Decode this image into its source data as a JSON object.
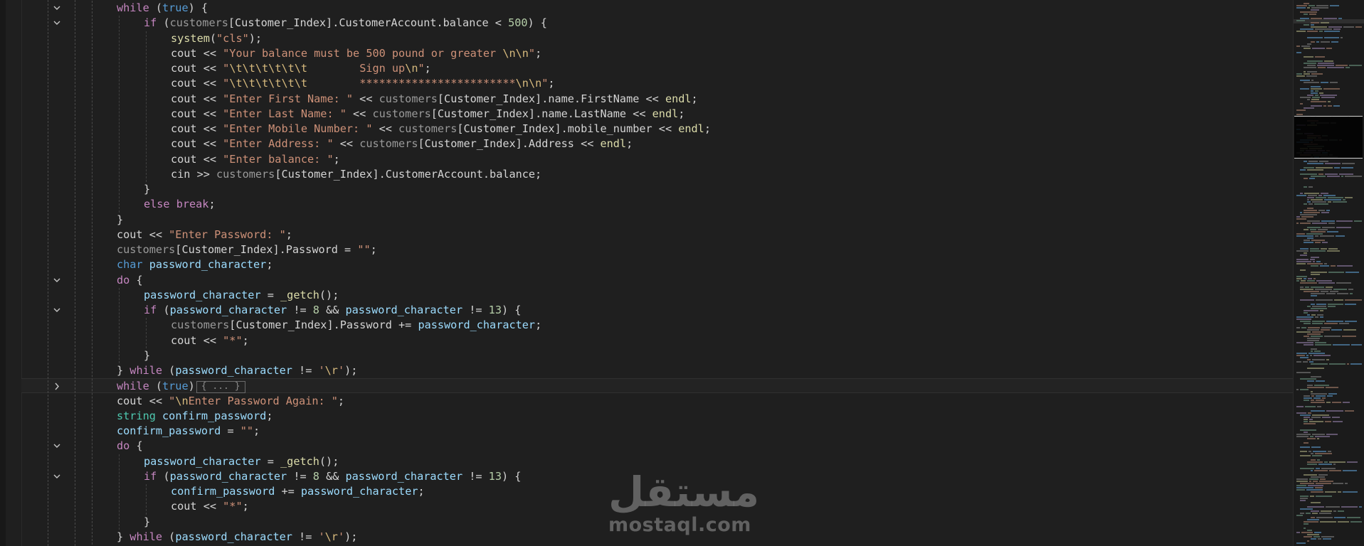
{
  "editor": {
    "collapsed_placeholder": "{ ... }",
    "lines": [
      {
        "fold": "expanded",
        "indent": 1,
        "tokens": [
          [
            "ctl",
            "while"
          ],
          [
            "txt",
            " ("
          ],
          [
            "kw",
            "true"
          ],
          [
            "txt",
            ") {"
          ]
        ]
      },
      {
        "fold": "expanded",
        "indent": 2,
        "tokens": [
          [
            "ctl",
            "if"
          ],
          [
            "txt",
            " ("
          ],
          [
            "gray",
            "customers"
          ],
          [
            "txt",
            "[Customer_Index].CustomerAccount.balance < "
          ],
          [
            "num",
            "500"
          ],
          [
            "txt",
            ") {"
          ]
        ]
      },
      {
        "fold": "none",
        "indent": 3,
        "tokens": [
          [
            "fn",
            "system"
          ],
          [
            "txt",
            "("
          ],
          [
            "str",
            "\"cls\""
          ],
          [
            "txt",
            ");"
          ]
        ]
      },
      {
        "fold": "none",
        "indent": 3,
        "tokens": [
          [
            "txt",
            "cout << "
          ],
          [
            "str",
            "\"Your balance must be 500 pound or greater "
          ],
          [
            "esc",
            "\\n\\n"
          ],
          [
            "str",
            "\""
          ],
          [
            "txt",
            ";"
          ]
        ]
      },
      {
        "fold": "none",
        "indent": 3,
        "tokens": [
          [
            "txt",
            "cout << "
          ],
          [
            "str",
            "\""
          ],
          [
            "esc",
            "\\t\\t\\t\\t\\t\\t"
          ],
          [
            "str",
            "        Sign up"
          ],
          [
            "esc",
            "\\n"
          ],
          [
            "str",
            "\""
          ],
          [
            "txt",
            ";"
          ]
        ]
      },
      {
        "fold": "none",
        "indent": 3,
        "tokens": [
          [
            "txt",
            "cout << "
          ],
          [
            "str",
            "\""
          ],
          [
            "esc",
            "\\t\\t\\t\\t\\t\\t"
          ],
          [
            "str",
            "        ************************"
          ],
          [
            "esc",
            "\\n\\n"
          ],
          [
            "str",
            "\""
          ],
          [
            "txt",
            ";"
          ]
        ]
      },
      {
        "fold": "none",
        "indent": 3,
        "tokens": [
          [
            "txt",
            "cout << "
          ],
          [
            "str",
            "\"Enter First Name: \""
          ],
          [
            "txt",
            " << "
          ],
          [
            "gray",
            "customers"
          ],
          [
            "txt",
            "[Customer_Index].name.FirstName << "
          ],
          [
            "fn",
            "endl"
          ],
          [
            "txt",
            ";"
          ]
        ]
      },
      {
        "fold": "none",
        "indent": 3,
        "tokens": [
          [
            "txt",
            "cout << "
          ],
          [
            "str",
            "\"Enter Last Name: \""
          ],
          [
            "txt",
            " << "
          ],
          [
            "gray",
            "customers"
          ],
          [
            "txt",
            "[Customer_Index].name.LastName << "
          ],
          [
            "fn",
            "endl"
          ],
          [
            "txt",
            ";"
          ]
        ]
      },
      {
        "fold": "none",
        "indent": 3,
        "tokens": [
          [
            "txt",
            "cout << "
          ],
          [
            "str",
            "\"Enter Mobile Number: \""
          ],
          [
            "txt",
            " << "
          ],
          [
            "gray",
            "customers"
          ],
          [
            "txt",
            "[Customer_Index].mobile_number << "
          ],
          [
            "fn",
            "endl"
          ],
          [
            "txt",
            ";"
          ]
        ]
      },
      {
        "fold": "none",
        "indent": 3,
        "tokens": [
          [
            "txt",
            "cout << "
          ],
          [
            "str",
            "\"Enter Address: \""
          ],
          [
            "txt",
            " << "
          ],
          [
            "gray",
            "customers"
          ],
          [
            "txt",
            "[Customer_Index].Address << "
          ],
          [
            "fn",
            "endl"
          ],
          [
            "txt",
            ";"
          ]
        ]
      },
      {
        "fold": "none",
        "indent": 3,
        "tokens": [
          [
            "txt",
            "cout << "
          ],
          [
            "str",
            "\"Enter balance: \""
          ],
          [
            "txt",
            ";"
          ]
        ]
      },
      {
        "fold": "none",
        "indent": 3,
        "tokens": [
          [
            "txt",
            "cin >> "
          ],
          [
            "gray",
            "customers"
          ],
          [
            "txt",
            "[Customer_Index].CustomerAccount.balance;"
          ]
        ]
      },
      {
        "fold": "none",
        "indent": 2,
        "tokens": [
          [
            "txt",
            "}"
          ]
        ]
      },
      {
        "fold": "none",
        "indent": 2,
        "tokens": [
          [
            "ctl",
            "else break"
          ],
          [
            "txt",
            ";"
          ]
        ]
      },
      {
        "fold": "none",
        "indent": 1,
        "tokens": [
          [
            "txt",
            "}"
          ]
        ]
      },
      {
        "fold": "none",
        "indent": 1,
        "tokens": [
          [
            "txt",
            "cout << "
          ],
          [
            "str",
            "\"Enter Password: \""
          ],
          [
            "txt",
            ";"
          ]
        ]
      },
      {
        "fold": "none",
        "indent": 1,
        "tokens": [
          [
            "gray",
            "customers"
          ],
          [
            "txt",
            "[Customer_Index].Password = "
          ],
          [
            "str",
            "\"\""
          ],
          [
            "txt",
            ";"
          ]
        ]
      },
      {
        "fold": "none",
        "indent": 1,
        "tokens": [
          [
            "kw",
            "char"
          ],
          [
            "txt",
            " "
          ],
          [
            "var",
            "password_character"
          ],
          [
            "txt",
            ";"
          ]
        ]
      },
      {
        "fold": "expanded",
        "indent": 1,
        "tokens": [
          [
            "ctl",
            "do"
          ],
          [
            "txt",
            " {"
          ]
        ]
      },
      {
        "fold": "none",
        "indent": 2,
        "tokens": [
          [
            "var",
            "password_character"
          ],
          [
            "txt",
            " = "
          ],
          [
            "fn",
            "_getch"
          ],
          [
            "txt",
            "();"
          ]
        ]
      },
      {
        "fold": "expanded",
        "indent": 2,
        "tokens": [
          [
            "ctl",
            "if"
          ],
          [
            "txt",
            " ("
          ],
          [
            "var",
            "password_character"
          ],
          [
            "txt",
            " != "
          ],
          [
            "num",
            "8"
          ],
          [
            "txt",
            " && "
          ],
          [
            "var",
            "password_character"
          ],
          [
            "txt",
            " != "
          ],
          [
            "num",
            "13"
          ],
          [
            "txt",
            ") {"
          ]
        ]
      },
      {
        "fold": "none",
        "indent": 3,
        "tokens": [
          [
            "gray",
            "customers"
          ],
          [
            "txt",
            "[Customer_Index].Password += "
          ],
          [
            "var",
            "password_character"
          ],
          [
            "txt",
            ";"
          ]
        ]
      },
      {
        "fold": "none",
        "indent": 3,
        "tokens": [
          [
            "txt",
            "cout << "
          ],
          [
            "str",
            "\"*\""
          ],
          [
            "txt",
            ";"
          ]
        ]
      },
      {
        "fold": "none",
        "indent": 2,
        "tokens": [
          [
            "txt",
            "}"
          ]
        ]
      },
      {
        "fold": "none",
        "indent": 1,
        "tokens": [
          [
            "txt",
            "} "
          ],
          [
            "ctl",
            "while"
          ],
          [
            "txt",
            " ("
          ],
          [
            "var",
            "password_character"
          ],
          [
            "txt",
            " != "
          ],
          [
            "str",
            "'"
          ],
          [
            "esc",
            "\\r"
          ],
          [
            "str",
            "'"
          ],
          [
            "txt",
            ");"
          ]
        ]
      },
      {
        "fold": "collapsed",
        "indent": 1,
        "current": true,
        "tokens": [
          [
            "ctl",
            "while"
          ],
          [
            "txt",
            " ("
          ],
          [
            "kw",
            "true"
          ],
          [
            "txt",
            ")"
          ]
        ]
      },
      {
        "fold": "none",
        "indent": 1,
        "tokens": [
          [
            "txt",
            "cout << "
          ],
          [
            "str",
            "\""
          ],
          [
            "esc",
            "\\n"
          ],
          [
            "str",
            "Enter Password Again: \""
          ],
          [
            "txt",
            ";"
          ]
        ]
      },
      {
        "fold": "none",
        "indent": 1,
        "tokens": [
          [
            "type",
            "string"
          ],
          [
            "txt",
            " "
          ],
          [
            "var",
            "confirm_password"
          ],
          [
            "txt",
            ";"
          ]
        ]
      },
      {
        "fold": "none",
        "indent": 1,
        "tokens": [
          [
            "var",
            "confirm_password"
          ],
          [
            "txt",
            " = "
          ],
          [
            "str",
            "\"\""
          ],
          [
            "txt",
            ";"
          ]
        ]
      },
      {
        "fold": "expanded",
        "indent": 1,
        "tokens": [
          [
            "ctl",
            "do"
          ],
          [
            "txt",
            " {"
          ]
        ]
      },
      {
        "fold": "none",
        "indent": 2,
        "tokens": [
          [
            "var",
            "password_character"
          ],
          [
            "txt",
            " = "
          ],
          [
            "fn",
            "_getch"
          ],
          [
            "txt",
            "();"
          ]
        ]
      },
      {
        "fold": "expanded",
        "indent": 2,
        "tokens": [
          [
            "ctl",
            "if"
          ],
          [
            "txt",
            " ("
          ],
          [
            "var",
            "password_character"
          ],
          [
            "txt",
            " != "
          ],
          [
            "num",
            "8"
          ],
          [
            "txt",
            " && "
          ],
          [
            "var",
            "password_character"
          ],
          [
            "txt",
            " != "
          ],
          [
            "num",
            "13"
          ],
          [
            "txt",
            ") {"
          ]
        ]
      },
      {
        "fold": "none",
        "indent": 3,
        "tokens": [
          [
            "var",
            "confirm_password"
          ],
          [
            "txt",
            " += "
          ],
          [
            "var",
            "password_character"
          ],
          [
            "txt",
            ";"
          ]
        ]
      },
      {
        "fold": "none",
        "indent": 3,
        "tokens": [
          [
            "txt",
            "cout << "
          ],
          [
            "str",
            "\"*\""
          ],
          [
            "txt",
            ";"
          ]
        ]
      },
      {
        "fold": "none",
        "indent": 2,
        "tokens": [
          [
            "txt",
            "}"
          ]
        ]
      },
      {
        "fold": "none",
        "indent": 1,
        "tokens": [
          [
            "txt",
            "} "
          ],
          [
            "ctl",
            "while"
          ],
          [
            "txt",
            " ("
          ],
          [
            "var",
            "password_character"
          ],
          [
            "txt",
            " != "
          ],
          [
            "str",
            "'"
          ],
          [
            "esc",
            "\\r"
          ],
          [
            "str",
            "'"
          ],
          [
            "txt",
            ");"
          ]
        ]
      }
    ]
  },
  "icons": {
    "fold_expanded": "chevron-down-icon",
    "fold_collapsed": "chevron-right-icon"
  },
  "watermark": {
    "arabic": "مستقل",
    "latin": "mostaql.com"
  }
}
